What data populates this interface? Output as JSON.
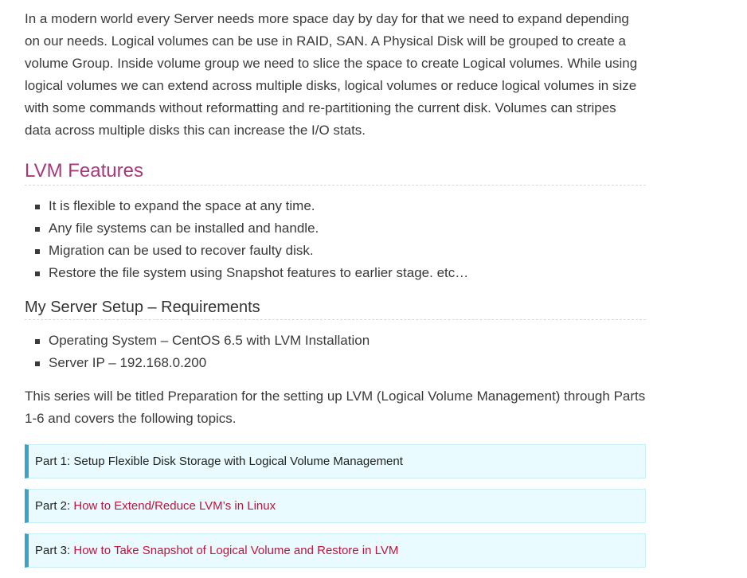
{
  "intro": {
    "paragraph": "In a modern world every Server needs more space day by day for that we need to expand depending on our needs. Logical volumes can be use in RAID, SAN. A Physical Disk will be grouped to create a volume Group. Inside volume group we need to slice the space to create Logical volumes. While using logical volumes we can extend across multiple disks, logical volumes or reduce logical volumes in size with some commands without reformatting and re-partitioning the current disk. Volumes can stripes data across multiple disks this can increase the I/O stats."
  },
  "features": {
    "heading": "LVM Features",
    "items": [
      "It is flexible to expand the space at any time.",
      "Any file systems can be installed and handle.",
      "Migration can be used to recover faulty disk.",
      "Restore the file system using Snapshot features to earlier stage. etc…"
    ]
  },
  "setup": {
    "heading": "My Server Setup – Requirements",
    "items": [
      "Operating System – CentOS 6.5 with LVM Installation",
      "Server IP – 192.168.0.200"
    ]
  },
  "series": {
    "text": "This series will be titled Preparation for the setting up LVM (Logical Volume Management) through Parts 1-6 and covers the following topics."
  },
  "parts": [
    {
      "prefix": "Part 1: ",
      "title": "Setup Flexible Disk Storage with Logical Volume Management",
      "is_link": false
    },
    {
      "prefix": "Part 2: ",
      "title": "How to Extend/Reduce LVM’s in Linux",
      "is_link": true
    },
    {
      "prefix": "Part 3: ",
      "title": "How to Take Snapshot of Logical Volume and Restore in LVM",
      "is_link": true
    }
  ],
  "colors": {
    "heading_accent": "#a7397a",
    "link": "#c0143c",
    "callout_bg": "#e9fbff",
    "callout_border": "#3aa3c7"
  }
}
